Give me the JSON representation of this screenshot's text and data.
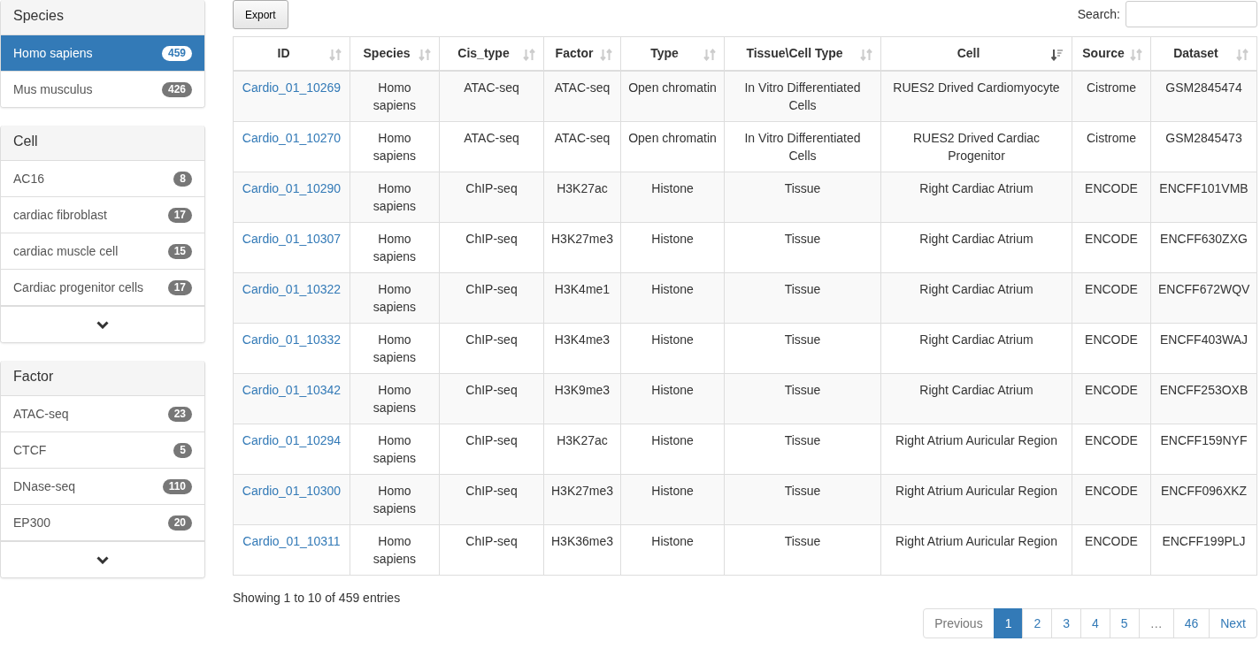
{
  "sidebar": [
    {
      "title": "Species",
      "items": [
        {
          "label": "Homo sapiens",
          "count": "459",
          "selected": true
        },
        {
          "label": "Mus musculus",
          "count": "426",
          "selected": false
        }
      ],
      "more": false
    },
    {
      "title": "Cell",
      "items": [
        {
          "label": "AC16",
          "count": "8",
          "selected": false
        },
        {
          "label": "cardiac fibroblast",
          "count": "17",
          "selected": false
        },
        {
          "label": "cardiac muscle cell",
          "count": "15",
          "selected": false
        },
        {
          "label": "Cardiac progenitor cells",
          "count": "17",
          "selected": false
        }
      ],
      "more": true
    },
    {
      "title": "Factor",
      "items": [
        {
          "label": "ATAC-seq",
          "count": "23",
          "selected": false
        },
        {
          "label": "CTCF",
          "count": "5",
          "selected": false
        },
        {
          "label": "DNase-seq",
          "count": "110",
          "selected": false
        },
        {
          "label": "EP300",
          "count": "20",
          "selected": false
        }
      ],
      "more": true
    }
  ],
  "toolbar": {
    "export_button": "Export",
    "search_label": "Search:"
  },
  "table": {
    "columns": [
      {
        "label": "ID",
        "sorted": false
      },
      {
        "label": "Species",
        "sorted": false
      },
      {
        "label": "Cis_type",
        "sorted": false
      },
      {
        "label": "Factor",
        "sorted": false
      },
      {
        "label": "Type",
        "sorted": false
      },
      {
        "label": "Tissue\\Cell Type",
        "sorted": false
      },
      {
        "label": "Cell",
        "sorted": true
      },
      {
        "label": "Source",
        "sorted": false
      },
      {
        "label": "Dataset",
        "sorted": false
      }
    ],
    "rows": [
      [
        "Cardio_01_10269",
        "Homo sapiens",
        "ATAC-seq",
        "ATAC-seq",
        "Open chromatin",
        "In Vitro Differentiated Cells",
        "RUES2 Drived Cardiomyocyte",
        "Cistrome",
        "GSM2845474"
      ],
      [
        "Cardio_01_10270",
        "Homo sapiens",
        "ATAC-seq",
        "ATAC-seq",
        "Open chromatin",
        "In Vitro Differentiated Cells",
        "RUES2 Drived Cardiac Progenitor",
        "Cistrome",
        "GSM2845473"
      ],
      [
        "Cardio_01_10290",
        "Homo sapiens",
        "ChIP-seq",
        "H3K27ac",
        "Histone",
        "Tissue",
        "Right Cardiac Atrium",
        "ENCODE",
        "ENCFF101VMB"
      ],
      [
        "Cardio_01_10307",
        "Homo sapiens",
        "ChIP-seq",
        "H3K27me3",
        "Histone",
        "Tissue",
        "Right Cardiac Atrium",
        "ENCODE",
        "ENCFF630ZXG"
      ],
      [
        "Cardio_01_10322",
        "Homo sapiens",
        "ChIP-seq",
        "H3K4me1",
        "Histone",
        "Tissue",
        "Right Cardiac Atrium",
        "ENCODE",
        "ENCFF672WQV"
      ],
      [
        "Cardio_01_10332",
        "Homo sapiens",
        "ChIP-seq",
        "H3K4me3",
        "Histone",
        "Tissue",
        "Right Cardiac Atrium",
        "ENCODE",
        "ENCFF403WAJ"
      ],
      [
        "Cardio_01_10342",
        "Homo sapiens",
        "ChIP-seq",
        "H3K9me3",
        "Histone",
        "Tissue",
        "Right Cardiac Atrium",
        "ENCODE",
        "ENCFF253OXB"
      ],
      [
        "Cardio_01_10294",
        "Homo sapiens",
        "ChIP-seq",
        "H3K27ac",
        "Histone",
        "Tissue",
        "Right Atrium Auricular Region",
        "ENCODE",
        "ENCFF159NYF"
      ],
      [
        "Cardio_01_10300",
        "Homo sapiens",
        "ChIP-seq",
        "H3K27me3",
        "Histone",
        "Tissue",
        "Right Atrium Auricular Region",
        "ENCODE",
        "ENCFF096XKZ"
      ],
      [
        "Cardio_01_10311",
        "Homo sapiens",
        "ChIP-seq",
        "H3K36me3",
        "Histone",
        "Tissue",
        "Right Atrium Auricular Region",
        "ENCODE",
        "ENCFF199PLJ"
      ]
    ]
  },
  "info": "Showing 1 to 10 of 459 entries",
  "pagination": [
    {
      "label": "Previous",
      "selected": false,
      "disabled": true
    },
    {
      "label": "1",
      "selected": true,
      "disabled": false
    },
    {
      "label": "2",
      "selected": false,
      "disabled": false
    },
    {
      "label": "3",
      "selected": false,
      "disabled": false
    },
    {
      "label": "4",
      "selected": false,
      "disabled": false
    },
    {
      "label": "5",
      "selected": false,
      "disabled": false
    },
    {
      "label": "…",
      "selected": false,
      "disabled": true
    },
    {
      "label": "46",
      "selected": false,
      "disabled": false
    },
    {
      "label": "Next",
      "selected": false,
      "disabled": false
    }
  ]
}
